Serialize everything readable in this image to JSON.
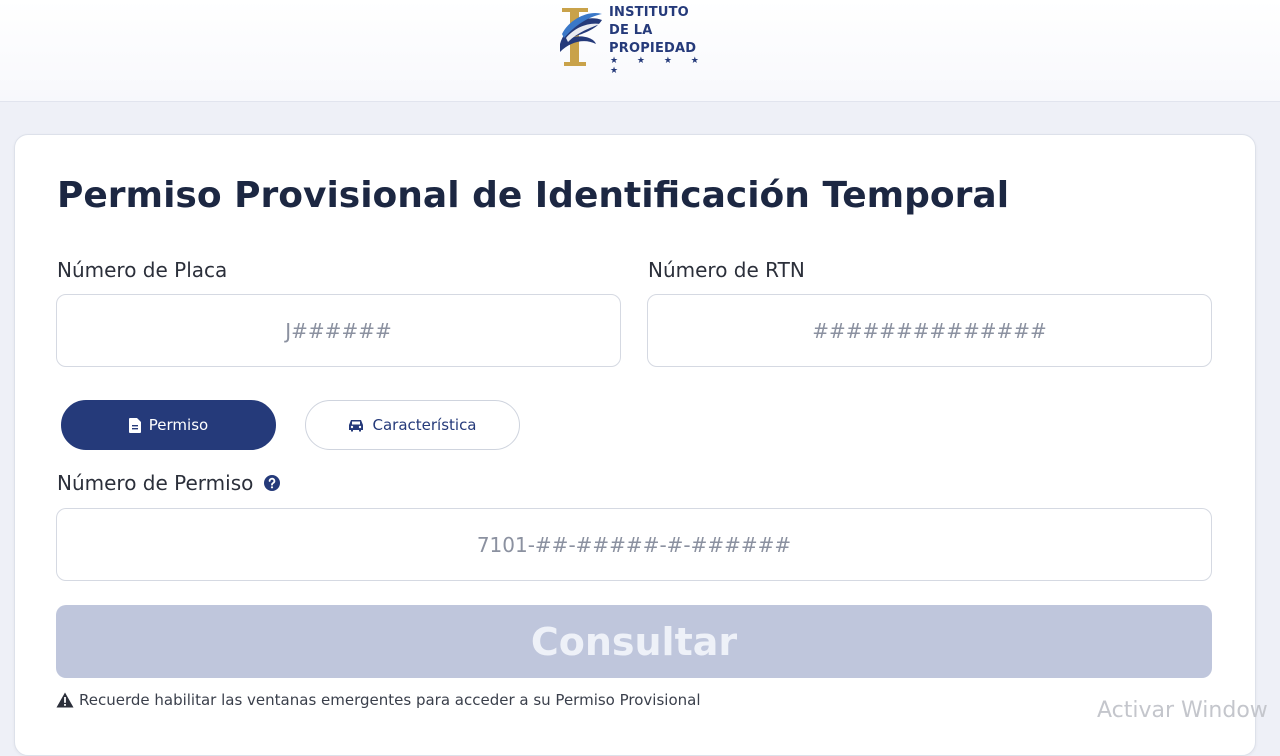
{
  "header": {
    "logo_lines": [
      "INSTITUTO",
      "DE LA",
      "PROPIEDAD"
    ],
    "logo_stars": "★ ★ ★ ★ ★",
    "colors": {
      "brand_navy": "#253a7a",
      "brand_gold": "#c9a24a"
    }
  },
  "form": {
    "title": "Permiso Provisional de Identificación Temporal",
    "plate": {
      "label": "Número de Placa",
      "placeholder": "J######",
      "value": ""
    },
    "rtn": {
      "label": "Número de RTN",
      "placeholder": "##############",
      "value": ""
    },
    "tabs": [
      {
        "label": "Permiso",
        "icon": "document-icon",
        "active": true
      },
      {
        "label": "Característica",
        "icon": "car-icon",
        "active": false
      }
    ],
    "permit": {
      "label": "Número de Permiso",
      "placeholder": "7101-##-#####-#-######",
      "value": "",
      "help_icon": "question-circle-icon"
    },
    "submit_label": "Consultar",
    "notice": "Recuerde habilitar las ventanas emergentes para acceder a su Permiso Provisional",
    "notice_icon": "warning-icon"
  },
  "overlay": {
    "watermark": "Activar Window"
  }
}
